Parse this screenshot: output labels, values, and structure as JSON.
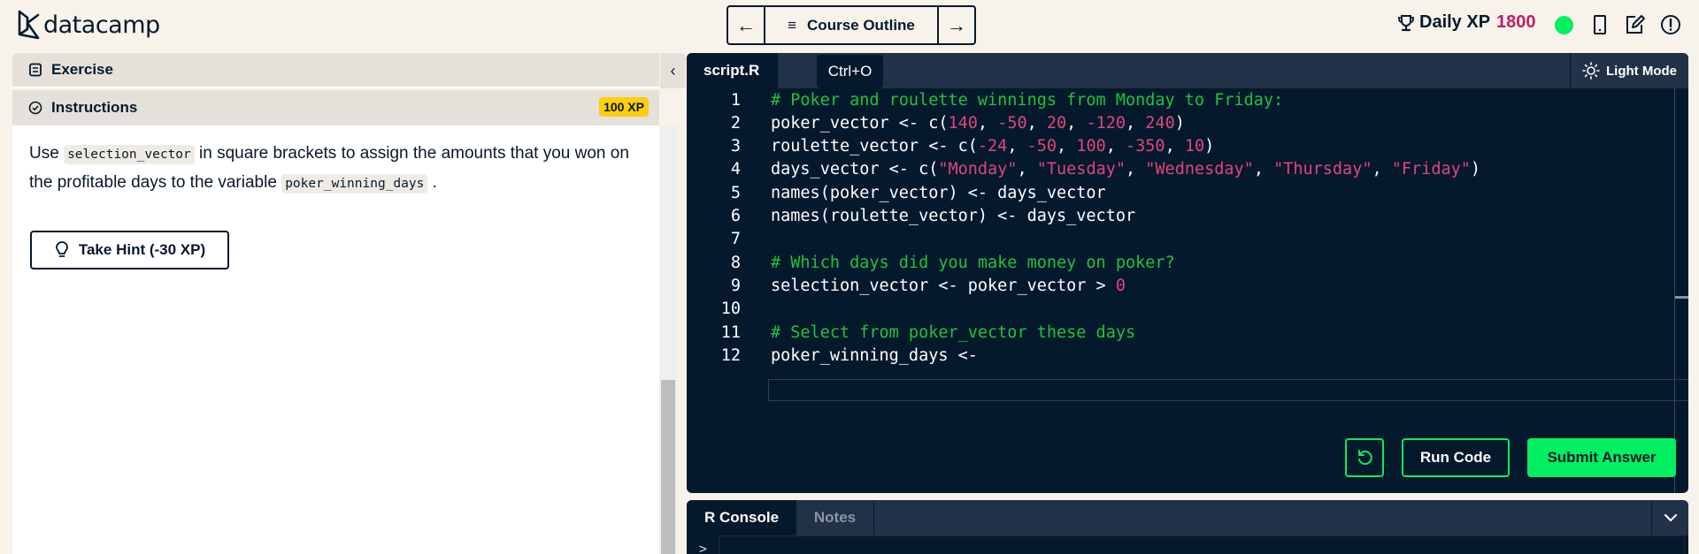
{
  "header": {
    "logo_text": "datacamp",
    "nav": {
      "prev_icon": "arrow-left-icon",
      "prev_glyph": "←",
      "outline_icon_glyph": "≡",
      "outline_label": "Course Outline",
      "next_icon": "arrow-right-icon",
      "next_glyph": "→"
    },
    "daily_xp": {
      "label": "Daily XP",
      "value": "1800",
      "value_color": "#c01c6a"
    },
    "status_color": "#03ef62"
  },
  "left_panel": {
    "exercise_label": "Exercise",
    "collapse_glyph": "‹",
    "instructions_label": "Instructions",
    "xp_badge": "100 XP",
    "instruction": {
      "part1": "Use ",
      "code1": "selection_vector",
      "part2": " in square brackets to assign the amounts that you won on the profitable days to the variable ",
      "code2": "poker_winning_days",
      "part3": " ."
    },
    "hint_button": "Take Hint (-30 XP)"
  },
  "editor": {
    "tab_label": "script.R",
    "tooltip": "Ctrl+O",
    "light_mode_label": "Light Mode",
    "lines": [
      {
        "n": "1",
        "tokens": [
          {
            "t": "# Poker and roulette winnings from Monday to Friday:",
            "k": "c"
          }
        ]
      },
      {
        "n": "2",
        "tokens": [
          {
            "t": "poker_vector <- c(",
            "k": "p"
          },
          {
            "t": "140",
            "k": "n"
          },
          {
            "t": ", ",
            "k": "p"
          },
          {
            "t": "-50",
            "k": "n"
          },
          {
            "t": ", ",
            "k": "p"
          },
          {
            "t": "20",
            "k": "n"
          },
          {
            "t": ", ",
            "k": "p"
          },
          {
            "t": "-120",
            "k": "n"
          },
          {
            "t": ", ",
            "k": "p"
          },
          {
            "t": "240",
            "k": "n"
          },
          {
            "t": ")",
            "k": "p"
          }
        ]
      },
      {
        "n": "3",
        "tokens": [
          {
            "t": "roulette_vector <- c(",
            "k": "p"
          },
          {
            "t": "-24",
            "k": "n"
          },
          {
            "t": ", ",
            "k": "p"
          },
          {
            "t": "-50",
            "k": "n"
          },
          {
            "t": ", ",
            "k": "p"
          },
          {
            "t": "100",
            "k": "n"
          },
          {
            "t": ", ",
            "k": "p"
          },
          {
            "t": "-350",
            "k": "n"
          },
          {
            "t": ", ",
            "k": "p"
          },
          {
            "t": "10",
            "k": "n"
          },
          {
            "t": ")",
            "k": "p"
          }
        ]
      },
      {
        "n": "4",
        "tokens": [
          {
            "t": "days_vector <- c(",
            "k": "p"
          },
          {
            "t": "\"Monday\"",
            "k": "s"
          },
          {
            "t": ", ",
            "k": "p"
          },
          {
            "t": "\"Tuesday\"",
            "k": "s"
          },
          {
            "t": ", ",
            "k": "p"
          },
          {
            "t": "\"Wednesday\"",
            "k": "s"
          },
          {
            "t": ", ",
            "k": "p"
          },
          {
            "t": "\"Thursday\"",
            "k": "s"
          },
          {
            "t": ", ",
            "k": "p"
          },
          {
            "t": "\"Friday\"",
            "k": "s"
          },
          {
            "t": ")",
            "k": "p"
          }
        ]
      },
      {
        "n": "5",
        "tokens": [
          {
            "t": "names(poker_vector) <- days_vector",
            "k": "p"
          }
        ]
      },
      {
        "n": "6",
        "tokens": [
          {
            "t": "names(roulette_vector) <- days_vector",
            "k": "p"
          }
        ]
      },
      {
        "n": "7",
        "tokens": []
      },
      {
        "n": "8",
        "tokens": [
          {
            "t": "# Which days did you make money on poker?",
            "k": "c"
          }
        ]
      },
      {
        "n": "9",
        "tokens": [
          {
            "t": "selection_vector <- poker_vector > ",
            "k": "p"
          },
          {
            "t": "0",
            "k": "n"
          }
        ]
      },
      {
        "n": "10",
        "tokens": []
      },
      {
        "n": "11",
        "tokens": [
          {
            "t": "# Select from poker_vector these days",
            "k": "c"
          }
        ]
      },
      {
        "n": "12",
        "tokens": [
          {
            "t": "poker_winning_days <-",
            "k": "p"
          }
        ]
      }
    ],
    "run_label": "Run Code",
    "submit_label": "Submit Answer",
    "accent": "#03ef62"
  },
  "console": {
    "tabs": [
      "R Console",
      "Notes"
    ],
    "active_tab": "R Console",
    "prompt": ">"
  }
}
